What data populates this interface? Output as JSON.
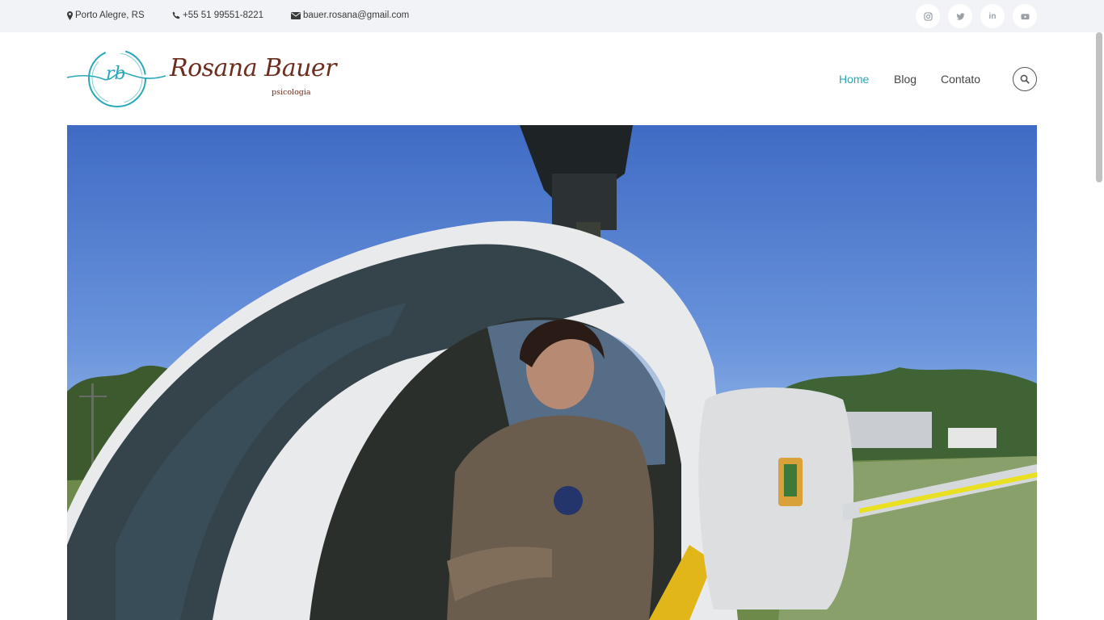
{
  "topbar": {
    "location": "Porto Alegre, RS",
    "phone": "+55 51 99551-8221",
    "email": "bauer.rosana@gmail.com",
    "social": [
      {
        "name": "instagram-icon"
      },
      {
        "name": "twitter-icon"
      },
      {
        "name": "linkedin-icon",
        "glyph": "in"
      },
      {
        "name": "youtube-icon"
      }
    ]
  },
  "logo": {
    "monogram": "rb",
    "name": "Rosana Bauer",
    "tagline": "psicologia"
  },
  "nav": {
    "items": [
      {
        "label": "Home",
        "active": true
      },
      {
        "label": "Blog",
        "active": false
      },
      {
        "label": "Contato",
        "active": false
      }
    ],
    "search_icon": "search-icon"
  },
  "colors": {
    "accent": "#2aa8b8",
    "brand": "#6b2d1e",
    "topbar_bg": "#f1f3f6"
  }
}
